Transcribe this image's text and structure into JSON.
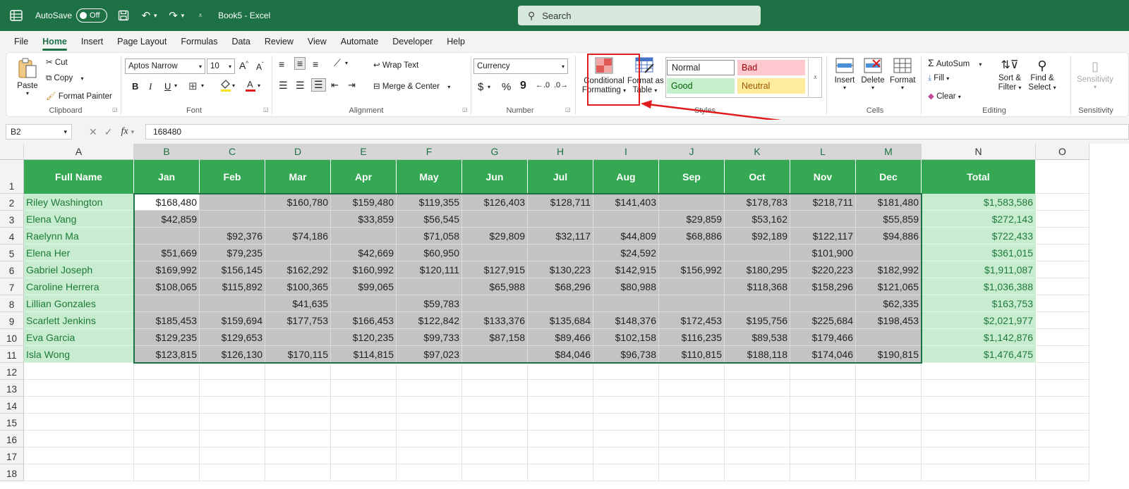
{
  "titlebar": {
    "autosave_label": "AutoSave",
    "autosave_state": "Off",
    "document_title": "Book5  -  Excel",
    "search_placeholder": "Search"
  },
  "menu": [
    "File",
    "Home",
    "Insert",
    "Page Layout",
    "Formulas",
    "Data",
    "Review",
    "View",
    "Automate",
    "Developer",
    "Help"
  ],
  "active_menu": "Home",
  "ribbon": {
    "clipboard": {
      "paste": "Paste",
      "cut": "Cut",
      "copy": "Copy",
      "format_painter": "Format Painter",
      "label": "Clipboard"
    },
    "font": {
      "name": "Aptos Narrow",
      "size": "10",
      "bold": "B",
      "italic": "I",
      "underline": "U",
      "label": "Font"
    },
    "alignment": {
      "wrap_text": "Wrap Text",
      "merge_center": "Merge & Center",
      "label": "Alignment"
    },
    "number": {
      "format": "Currency",
      "dollar": "$",
      "percent": "%",
      "comma": "9",
      "label": "Number"
    },
    "styles": {
      "conditional_formatting_line1": "Conditional",
      "conditional_formatting_line2": "Formatting",
      "format_as_table_line1": "Format as",
      "format_as_table_line2": "Table",
      "normal": "Normal",
      "bad": "Bad",
      "good": "Good",
      "neutral": "Neutral",
      "label": "Styles"
    },
    "cells": {
      "insert": "Insert",
      "delete": "Delete",
      "format": "Format",
      "label": "Cells"
    },
    "editing": {
      "autosum": "AutoSum",
      "fill": "Fill",
      "clear": "Clear",
      "sort_filter_line1": "Sort &",
      "sort_filter_line2": "Filter",
      "find_select_line1": "Find &",
      "find_select_line2": "Select",
      "label": "Editing"
    },
    "sensitivity": {
      "button": "Sensitivity",
      "label": "Sensitivity"
    }
  },
  "formula_bar": {
    "name_box": "B2",
    "fx": "fx",
    "value": "168480"
  },
  "columns": [
    "A",
    "B",
    "C",
    "D",
    "E",
    "F",
    "G",
    "H",
    "I",
    "J",
    "K",
    "L",
    "M",
    "N",
    "O"
  ],
  "rows": [
    "1",
    "2",
    "3",
    "4",
    "5",
    "6",
    "7",
    "8",
    "9",
    "10",
    "11",
    "12",
    "13",
    "14",
    "15",
    "16",
    "17",
    "18"
  ],
  "headers": [
    "Full Name",
    "Jan",
    "Feb",
    "Mar",
    "Apr",
    "May",
    "Jun",
    "Jul",
    "Aug",
    "Sep",
    "Oct",
    "Nov",
    "Dec",
    "Total"
  ],
  "data": [
    [
      "Riley Washington",
      "$168,480",
      "",
      "$160,780",
      "$159,480",
      "$119,355",
      "$126,403",
      "$128,711",
      "$141,403",
      "",
      "$178,783",
      "$218,711",
      "$181,480",
      "$1,583,586"
    ],
    [
      "Elena Vang",
      "$42,859",
      "",
      "",
      "$33,859",
      "$56,545",
      "",
      "",
      "",
      "$29,859",
      "$53,162",
      "",
      "$55,859",
      "$272,143"
    ],
    [
      "Raelynn Ma",
      "",
      "$92,376",
      "$74,186",
      "",
      "$71,058",
      "$29,809",
      "$32,117",
      "$44,809",
      "$68,886",
      "$92,189",
      "$122,117",
      "$94,886",
      "$722,433"
    ],
    [
      "Elena Her",
      "$51,669",
      "$79,235",
      "",
      "$42,669",
      "$60,950",
      "",
      "",
      "$24,592",
      "",
      "",
      "$101,900",
      "",
      "$361,015"
    ],
    [
      "Gabriel Joseph",
      "$169,992",
      "$156,145",
      "$162,292",
      "$160,992",
      "$120,111",
      "$127,915",
      "$130,223",
      "$142,915",
      "$156,992",
      "$180,295",
      "$220,223",
      "$182,992",
      "$1,911,087"
    ],
    [
      "Caroline Herrera",
      "$108,065",
      "$115,892",
      "$100,365",
      "$99,065",
      "",
      "$65,988",
      "$68,296",
      "$80,988",
      "",
      "$118,368",
      "$158,296",
      "$121,065",
      "$1,036,388"
    ],
    [
      "Lillian Gonzales",
      "",
      "",
      "$41,635",
      "",
      "$59,783",
      "",
      "",
      "",
      "",
      "",
      "",
      "$62,335",
      "$163,753"
    ],
    [
      "Scarlett Jenkins",
      "$185,453",
      "$159,694",
      "$177,753",
      "$166,453",
      "$122,842",
      "$133,376",
      "$135,684",
      "$148,376",
      "$172,453",
      "$195,756",
      "$225,684",
      "$198,453",
      "$2,021,977"
    ],
    [
      "Eva Garcia",
      "$129,235",
      "$129,653",
      "",
      "$120,235",
      "$99,733",
      "$87,158",
      "$89,466",
      "$102,158",
      "$116,235",
      "$89,538",
      "$179,466",
      "",
      "$1,142,876"
    ],
    [
      "Isla Wong",
      "$123,815",
      "$126,130",
      "$170,115",
      "$114,815",
      "$97,023",
      "",
      "$84,046",
      "$96,738",
      "$110,815",
      "$188,118",
      "$174,046",
      "$190,815",
      "$1,476,475"
    ]
  ],
  "colors": {
    "excel_green": "#1e7145",
    "header_green": "#34a853",
    "name_fill": "#c7eccf",
    "selection_fill": "#c3c3c3",
    "highlight_red": "#e01b1b"
  }
}
